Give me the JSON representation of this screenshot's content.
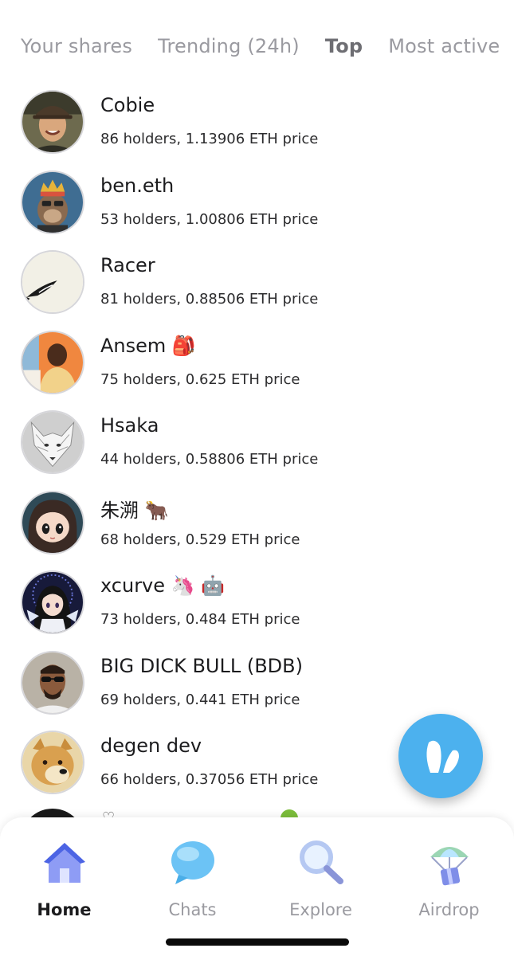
{
  "tabs": [
    {
      "label": "Your shares",
      "active": false
    },
    {
      "label": "Trending (24h)",
      "active": false
    },
    {
      "label": "Top",
      "active": true
    },
    {
      "label": "Most active",
      "active": false
    }
  ],
  "users": [
    {
      "name": "Cobie",
      "subtitle": "86 holders, 1.13906 ETH price",
      "avatar": "photo-man-cap-icon"
    },
    {
      "name": "ben.eth",
      "subtitle": "53 holders, 1.00806 ETH price",
      "avatar": "ape-crown-icon"
    },
    {
      "name": "Racer",
      "subtitle": "81 holders, 0.88506 ETH price",
      "avatar": "ink-fish-icon"
    },
    {
      "name": "Ansem 🎒",
      "subtitle": "75 holders, 0.625 ETH price",
      "avatar": "photo-man-orange-icon"
    },
    {
      "name": "Hsaka",
      "subtitle": "44 holders, 0.58806 ETH price",
      "avatar": "white-wolf-icon"
    },
    {
      "name": "朱溯 🐂",
      "subtitle": "68 holders, 0.529 ETH price",
      "avatar": "anime-girl-icon"
    },
    {
      "name": "xcurve 🦄 🤖",
      "subtitle": "73 holders, 0.484 ETH price",
      "avatar": "anime-girl-dark-icon"
    },
    {
      "name": "BIG DICK BULL (BDB)",
      "subtitle": "69 holders, 0.441 ETH price",
      "avatar": "photo-man-sunglasses-icon"
    },
    {
      "name": "degen dev",
      "subtitle": "66 holders, 0.37056 ETH price",
      "avatar": "doge-icon"
    }
  ],
  "partial_row": {
    "glyph": "♡"
  },
  "fab": {
    "icon": "bunny-ears-icon"
  },
  "nav": [
    {
      "label": "Home",
      "icon": "house-icon",
      "active": true
    },
    {
      "label": "Chats",
      "icon": "chat-bubble-icon",
      "active": false
    },
    {
      "label": "Explore",
      "icon": "magnifier-icon",
      "active": false
    },
    {
      "label": "Airdrop",
      "icon": "parachute-gift-icon",
      "active": false
    }
  ],
  "colors": {
    "accent": "#4cb1ee",
    "text_primary": "#1c1c1e",
    "text_muted": "#9a9aa0"
  }
}
